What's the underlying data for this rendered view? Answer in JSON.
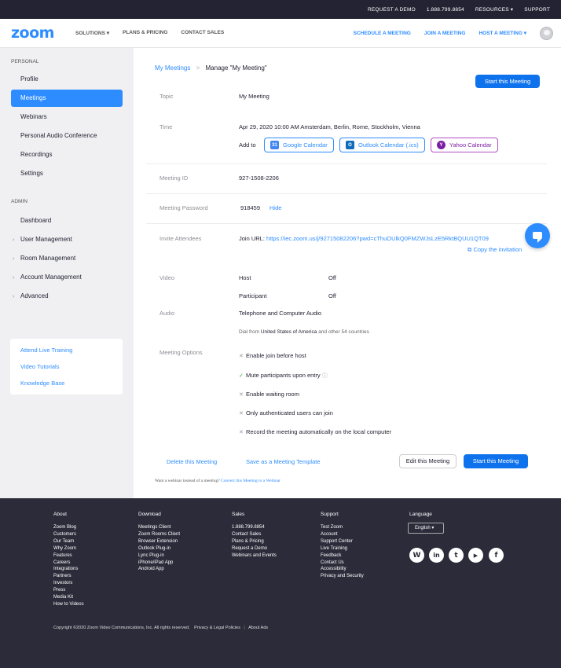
{
  "topbar": {
    "request_demo": "REQUEST A DEMO",
    "phone": "1.888.799.8854",
    "resources": "RESOURCES ▾",
    "support": "SUPPORT"
  },
  "header": {
    "logo": "zoom",
    "nav": [
      "SOLUTIONS ▾",
      "PLANS & PRICING",
      "CONTACT SALES"
    ],
    "schedule": "SCHEDULE A MEETING",
    "join": "JOIN A MEETING",
    "host": "HOST A MEETING ▾"
  },
  "sidebar": {
    "personal_label": "PERSONAL",
    "personal_items": [
      "Profile",
      "Meetings",
      "Webinars",
      "Personal Audio Conference",
      "Recordings",
      "Settings"
    ],
    "admin_label": "ADMIN",
    "admin_items": [
      "Dashboard",
      "User Management",
      "Room Management",
      "Account Management",
      "Advanced"
    ],
    "help_links": [
      "Attend Live Training",
      "Video Tutorials",
      "Knowledge Base"
    ]
  },
  "main": {
    "breadcrumb_link": "My Meetings",
    "breadcrumb_sep": ">",
    "breadcrumb_current": "Manage \"My Meeting\"",
    "start_button": "Start this Meeting",
    "topic_label": "Topic",
    "topic": "My Meeting",
    "time_label": "Time",
    "time": "Apr 29, 2020 10:00 AM Amsterdam, Berlin, Rome, Stockholm, Vienna",
    "add_to": "Add to",
    "google_cal": "Google Calendar",
    "outlook_cal": "Outlook Calendar (.ics)",
    "yahoo_cal": "Yahoo Calendar",
    "meeting_id_label": "Meeting ID",
    "meeting_id": "927-1508-2206",
    "password_label": "Meeting Password",
    "password": "918459",
    "hide": "Hide",
    "invite_label": "Invite Attendees",
    "join_url_label": "Join URL:",
    "join_url": "https://iec.zoom.us/j/92715082206?pwd=cThuOUlkQ0FMZWJsLzE5RktBQUU1QT09",
    "copy_invitation": "Copy the invitation",
    "video_label": "Video",
    "host": "Host",
    "host_val": "Off",
    "participant": "Participant",
    "participant_val": "Off",
    "audio_label": "Audio",
    "audio": "Telephone and Computer Audio",
    "dial_from": "Dial from",
    "dial_country": "United States of America",
    "dial_rest": "and other 54 countries",
    "options_label": "Meeting Options",
    "options": [
      {
        "text": "Enable join before host",
        "on": false
      },
      {
        "text": "Mute participants upon entry",
        "on": true
      },
      {
        "text": "Enable waiting room",
        "on": false
      },
      {
        "text": "Only authenticated users can join",
        "on": false
      },
      {
        "text": "Record the meeting automatically on the local computer",
        "on": false
      }
    ],
    "delete": "Delete this Meeting",
    "save_template": "Save as a Meeting Template",
    "edit": "Edit this Meeting",
    "start_bottom": "Start this Meeting",
    "webinar_q": "Want a webinar instead of a meeting?",
    "webinar_link": "Convert this Meeting to a Webinar"
  },
  "footer": {
    "about": {
      "title": "About",
      "items": [
        "Zoom Blog",
        "Customers",
        "Our Team",
        "Why Zoom",
        "Features",
        "Careers",
        "Integrations",
        "Partners",
        "Investors",
        "Press",
        "Media Kit",
        "How to Videos"
      ]
    },
    "download": {
      "title": "Download",
      "items": [
        "Meetings Client",
        "Zoom Rooms Client",
        "Browser Extension",
        "Outlook Plug-in",
        "Lync Plug-in",
        "iPhone/iPad App",
        "Android App"
      ]
    },
    "sales": {
      "title": "Sales",
      "items": [
        "1.888.799.8854",
        "Contact Sales",
        "Plans & Pricing",
        "Request a Demo",
        "Webinars and Events"
      ]
    },
    "support": {
      "title": "Support",
      "items": [
        "Test Zoom",
        "Account",
        "Support Center",
        "Live Training",
        "Feedback",
        "Contact Us",
        "Accessibility",
        "Privacy and Security"
      ]
    },
    "language_title": "Language",
    "language": "English ▾",
    "social": [
      "wordpress-icon",
      "linkedin-icon",
      "twitter-icon",
      "youtube-icon",
      "facebook-icon"
    ],
    "copyright": "Copyright ©2020 Zoom Video Communications, Inc. All rights reserved.",
    "privacy": "Privacy & Legal Policies",
    "about_ads": "About Ads"
  }
}
